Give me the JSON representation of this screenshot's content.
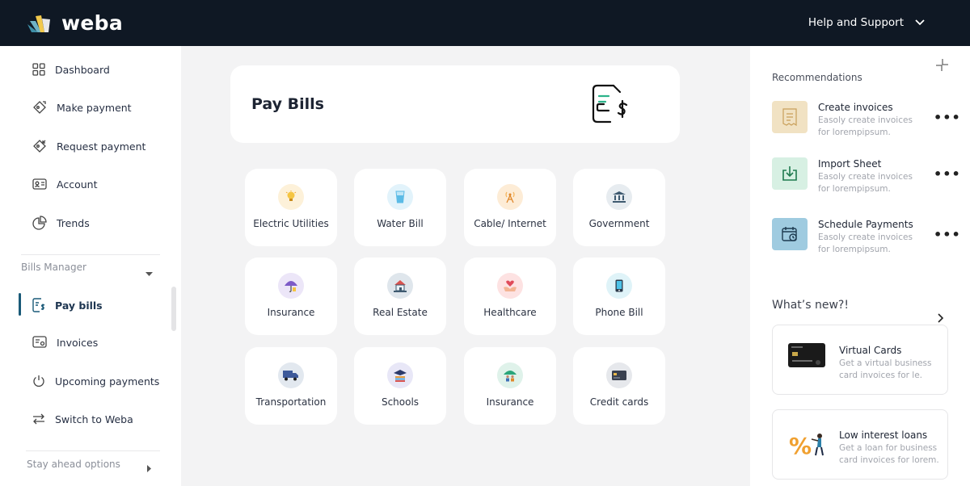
{
  "brand": {
    "name": "weba"
  },
  "header": {
    "help_label": "Help and Support"
  },
  "sidebar": {
    "items": [
      {
        "label": "Dashboard"
      },
      {
        "label": "Make payment"
      },
      {
        "label": "Request payment"
      },
      {
        "label": "Account"
      },
      {
        "label": "Trends"
      }
    ],
    "bills_manager": {
      "label": "Bills Manager",
      "items": [
        {
          "label": "Pay bills",
          "active": true
        },
        {
          "label": "Invoices"
        },
        {
          "label": "Upcoming payments"
        },
        {
          "label": "Switch to Weba"
        }
      ]
    },
    "stay_ahead_label": "Stay ahead options"
  },
  "main": {
    "title": "Pay Bills",
    "tiles": [
      {
        "label": "Electric Utilities",
        "icon": "bulb-icon"
      },
      {
        "label": "Water Bill",
        "icon": "water-glass-icon"
      },
      {
        "label": "Cable/ Internet",
        "icon": "antenna-icon"
      },
      {
        "label": "Government",
        "icon": "government-building-icon"
      },
      {
        "label": "Insurance",
        "icon": "umbrella-icon"
      },
      {
        "label": "Real Estate",
        "icon": "house-icon"
      },
      {
        "label": "Healthcare",
        "icon": "heart-hands-icon"
      },
      {
        "label": "Phone Bill",
        "icon": "phone-icon"
      },
      {
        "label": "Transportation",
        "icon": "truck-icon"
      },
      {
        "label": "Schools",
        "icon": "graduation-cap-icon"
      },
      {
        "label": "Insurance",
        "icon": "family-umbrella-icon"
      },
      {
        "label": "Credit cards",
        "icon": "credit-card-icon"
      }
    ]
  },
  "right": {
    "recommendations_title": "Recommendations",
    "recommendations": [
      {
        "title": "Create invoices",
        "desc": "Easoly create invoices for lorempipsum.",
        "icon": "receipt-icon",
        "color": "#f1e2c3"
      },
      {
        "title": "Import Sheet",
        "desc": "Easoly create invoices for lorempipsum.",
        "icon": "download-icon",
        "color": "#d7f0e3"
      },
      {
        "title": "Schedule Payments",
        "desc": "Easoly create invoices for lorempipsum.",
        "icon": "calendar-clock-icon",
        "color": "#9fcbe0"
      }
    ],
    "whats_new_title": "What’s new?!",
    "promos": [
      {
        "title": "Virtual Cards",
        "desc": "Get a virtual business card invoices for le."
      },
      {
        "title": "Low interest loans",
        "desc": "Get a loan for  business card invoices for lorem."
      }
    ]
  },
  "colors": {
    "topbar": "#0f1824",
    "accent": "#1a5a78",
    "canvas": "#f3f3f4"
  }
}
